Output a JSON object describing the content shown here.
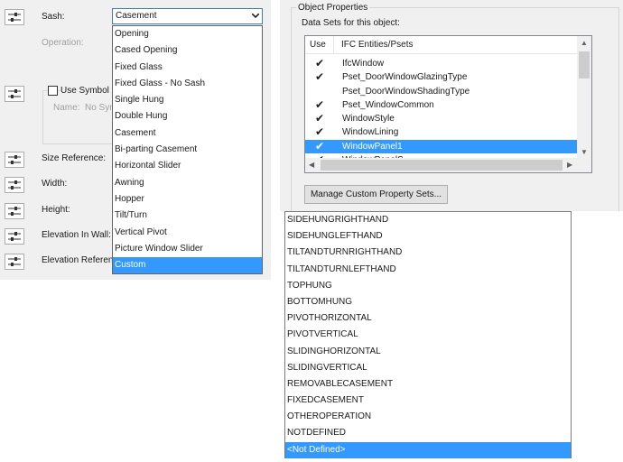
{
  "left_panel": {
    "sash_label": "Sash:",
    "sash_value": "Casement",
    "operation_label": "Operation:",
    "use_symbol_label": "Use Symbol C",
    "name_label": "Name:",
    "name_value": "No Syn",
    "size_reference_label": "Size Reference:",
    "width_label": "Width:",
    "height_label": "Height:",
    "elevation_in_wall_label": "Elevation In Wall:",
    "elevation_reference_label": "Elevation Referen",
    "sash_options": [
      "Opening",
      "Cased Opening",
      "Fixed Glass",
      "Fixed Glass - No Sash",
      "Single Hung",
      "Double Hung",
      "Casement",
      "Bi-parting Casement",
      "Horizontal Slider",
      "Awning",
      "Hopper",
      "Tilt/Turn",
      "Vertical Pivot",
      "Picture Window Slider",
      "Custom"
    ],
    "sash_selected": "Custom"
  },
  "object_properties": {
    "group_title": "Object Properties",
    "datasets_label": "Data Sets for this object:",
    "col_use": "Use",
    "col_ifc": "IFC Entities/Psets",
    "rows": [
      {
        "use": "✔",
        "name": "IfcWindow"
      },
      {
        "use": "✔",
        "name": "Pset_DoorWindowGlazingType"
      },
      {
        "use": "",
        "name": "Pset_DoorWindowShadingType"
      },
      {
        "use": "✔",
        "name": "Pset_WindowCommon"
      },
      {
        "use": "✔",
        "name": "WindowStyle"
      },
      {
        "use": "✔",
        "name": "WindowLining"
      },
      {
        "use": "✔",
        "name": "WindowPanel1"
      },
      {
        "use": "✔",
        "name": "WindowPanelS"
      }
    ],
    "selected_row": "WindowPanel1",
    "manage_button": "Manage Custom Property Sets..."
  },
  "operation_options": [
    "SIDEHUNGRIGHTHAND",
    "SIDEHUNGLEFTHAND",
    "TILTANDTURNRIGHTHAND",
    "TILTANDTURNLEFTHAND",
    "TOPHUNG",
    "BOTTOMHUNG",
    "PIVOTHORIZONTAL",
    "PIVOTVERTICAL",
    "SLIDINGHORIZONTAL",
    "SLIDINGVERTICAL",
    "REMOVABLECASEMENT",
    "FIXEDCASEMENT",
    "OTHEROPERATION",
    "NOTDEFINED",
    "<Not Defined>"
  ],
  "operation_selected": "<Not Defined>",
  "colors": {
    "selection": "#3399ff",
    "panel_bg": "#f0f0f0",
    "focus_border": "#3c7fb1"
  }
}
